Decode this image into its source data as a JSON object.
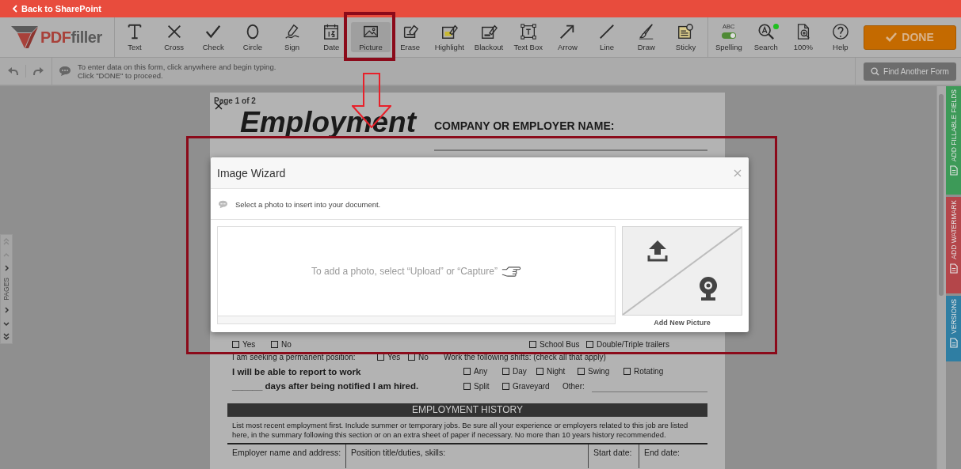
{
  "top_bar": {
    "back_link": "Back to SharePoint"
  },
  "logo": {
    "brand": "PDF",
    "suffix": "filler"
  },
  "toolbar": {
    "tools": [
      {
        "label": "Text",
        "kind": "text",
        "selected": false
      },
      {
        "label": "Cross",
        "kind": "cross",
        "selected": false
      },
      {
        "label": "Check",
        "kind": "check",
        "selected": false
      },
      {
        "label": "Circle",
        "kind": "circle",
        "selected": false
      },
      {
        "label": "Sign",
        "kind": "sign",
        "selected": false
      },
      {
        "label": "Date",
        "kind": "date",
        "selected": false
      },
      {
        "label": "Picture",
        "kind": "picture",
        "selected": true
      },
      {
        "label": "Erase",
        "kind": "erase",
        "selected": false
      },
      {
        "label": "Highlight",
        "kind": "highlight",
        "selected": false
      },
      {
        "label": "Blackout",
        "kind": "blackout",
        "selected": false
      },
      {
        "label": "Text Box",
        "kind": "textbox",
        "selected": false
      },
      {
        "label": "Arrow",
        "kind": "arrow",
        "selected": false
      },
      {
        "label": "Line",
        "kind": "line",
        "selected": false
      },
      {
        "label": "Draw",
        "kind": "draw",
        "selected": false
      },
      {
        "label": "Sticky",
        "kind": "sticky",
        "selected": false
      }
    ],
    "utilities": [
      {
        "label": "Spelling",
        "kind": "spelling",
        "caption": "ABC",
        "on": true
      },
      {
        "label": "Search",
        "kind": "search",
        "notification": true
      },
      {
        "label": "100%",
        "kind": "zoom"
      },
      {
        "label": "Help",
        "kind": "help"
      }
    ],
    "done_button": "DONE"
  },
  "message_bar": {
    "lines": [
      "To enter data on this form, click anywhere and begin typing.",
      "Click \"DONE\" to proceed."
    ],
    "find_button": "Find Another Form"
  },
  "document": {
    "page_label": "Page 1 of 2",
    "title": "Employment",
    "company_label": "COMPANY OR EMPLOYER NAME:",
    "eligibility_options": [
      {
        "label": "Yes",
        "checked": false
      },
      {
        "label": "No",
        "checked": false
      }
    ],
    "endorsements": [
      {
        "label": "School Bus",
        "checked": false
      },
      {
        "label": "Double/Triple trailers",
        "checked": false
      }
    ],
    "permanent": {
      "question": "I am seeking a permanent position:",
      "options": [
        {
          "label": "Yes",
          "checked": false
        },
        {
          "label": "No",
          "checked": false
        }
      ]
    },
    "shifts": {
      "label": "Work the following shifts: (check all that apply)",
      "options": [
        [
          {
            "label": "Any",
            "checked": false
          },
          {
            "label": "Day",
            "checked": false
          },
          {
            "label": "Night",
            "checked": false
          },
          {
            "label": "Swing",
            "checked": false
          },
          {
            "label": "Rotating",
            "checked": false
          }
        ],
        [
          {
            "label": "Split",
            "checked": false
          },
          {
            "label": "Graveyard",
            "checked": false
          }
        ]
      ],
      "other_label": "Other:"
    },
    "report_lines": [
      "I will be able to report to work",
      "______ days after being notified I am hired."
    ],
    "history": {
      "heading": "EMPLOYMENT HISTORY",
      "instructions": "List most recent employment first. Include summer or temporary jobs. Be sure all your experience or employers related to this job are listed here, in the summary following this section or on an extra sheet of paper if necessary. No more than 10 years history recommended.",
      "columns": [
        "Employer name and address:",
        "Position title/duties, skills:",
        "Start date:",
        "End date:"
      ]
    }
  },
  "modal": {
    "title": "Image Wizard",
    "hint": "Select a photo to insert into your document.",
    "drop_text": "To add a photo, select “Upload” or “Capture”",
    "tile_label": "Add New Picture"
  },
  "pages_nav": {
    "label": "PAGES"
  },
  "side_tabs": [
    {
      "label": "ADD FILLABLE FIELDS",
      "color": "#3d9a58"
    },
    {
      "label": "ADD WATERMARK",
      "color": "#b4464a"
    },
    {
      "label": "VERSIONS",
      "color": "#2f7ea3"
    }
  ]
}
